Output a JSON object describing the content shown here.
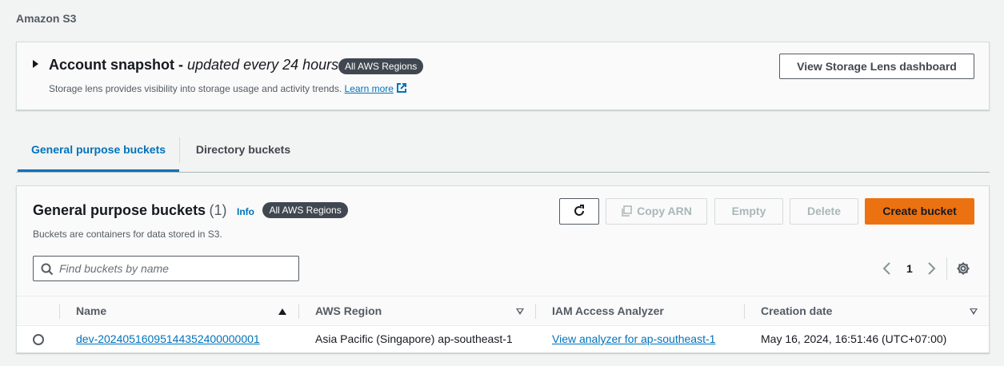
{
  "breadcrumb": "Amazon S3",
  "snapshot": {
    "title": "Account snapshot",
    "title_suffix": "updated every 24 hours",
    "badge": "All AWS Regions",
    "description": "Storage lens provides visibility into storage usage and activity trends.",
    "learn_more": "Learn more",
    "button": "View Storage Lens dashboard"
  },
  "tabs": [
    {
      "label": "General purpose buckets",
      "selected": true
    },
    {
      "label": "Directory buckets",
      "selected": false
    }
  ],
  "panel": {
    "title": "General purpose buckets",
    "count": "(1)",
    "info": "Info",
    "badge": "All AWS Regions",
    "description": "Buckets are containers for data stored in S3.",
    "buttons": {
      "copy_arn": "Copy ARN",
      "empty": "Empty",
      "delete": "Delete",
      "create": "Create bucket"
    },
    "search_placeholder": "Find buckets by name",
    "page": "1"
  },
  "table": {
    "columns": [
      "Name",
      "AWS Region",
      "IAM Access Analyzer",
      "Creation date"
    ],
    "rows": [
      {
        "name": "dev-20240516095144352400000001",
        "region": "Asia Pacific (Singapore) ap-southeast-1",
        "analyzer": "View analyzer for ap-southeast-1",
        "created": "May 16, 2024, 16:51:46 (UTC+07:00)"
      }
    ]
  },
  "colors": {
    "accent": "#0073bb",
    "primary_button": "#ec7211",
    "badge_bg": "#414750"
  }
}
